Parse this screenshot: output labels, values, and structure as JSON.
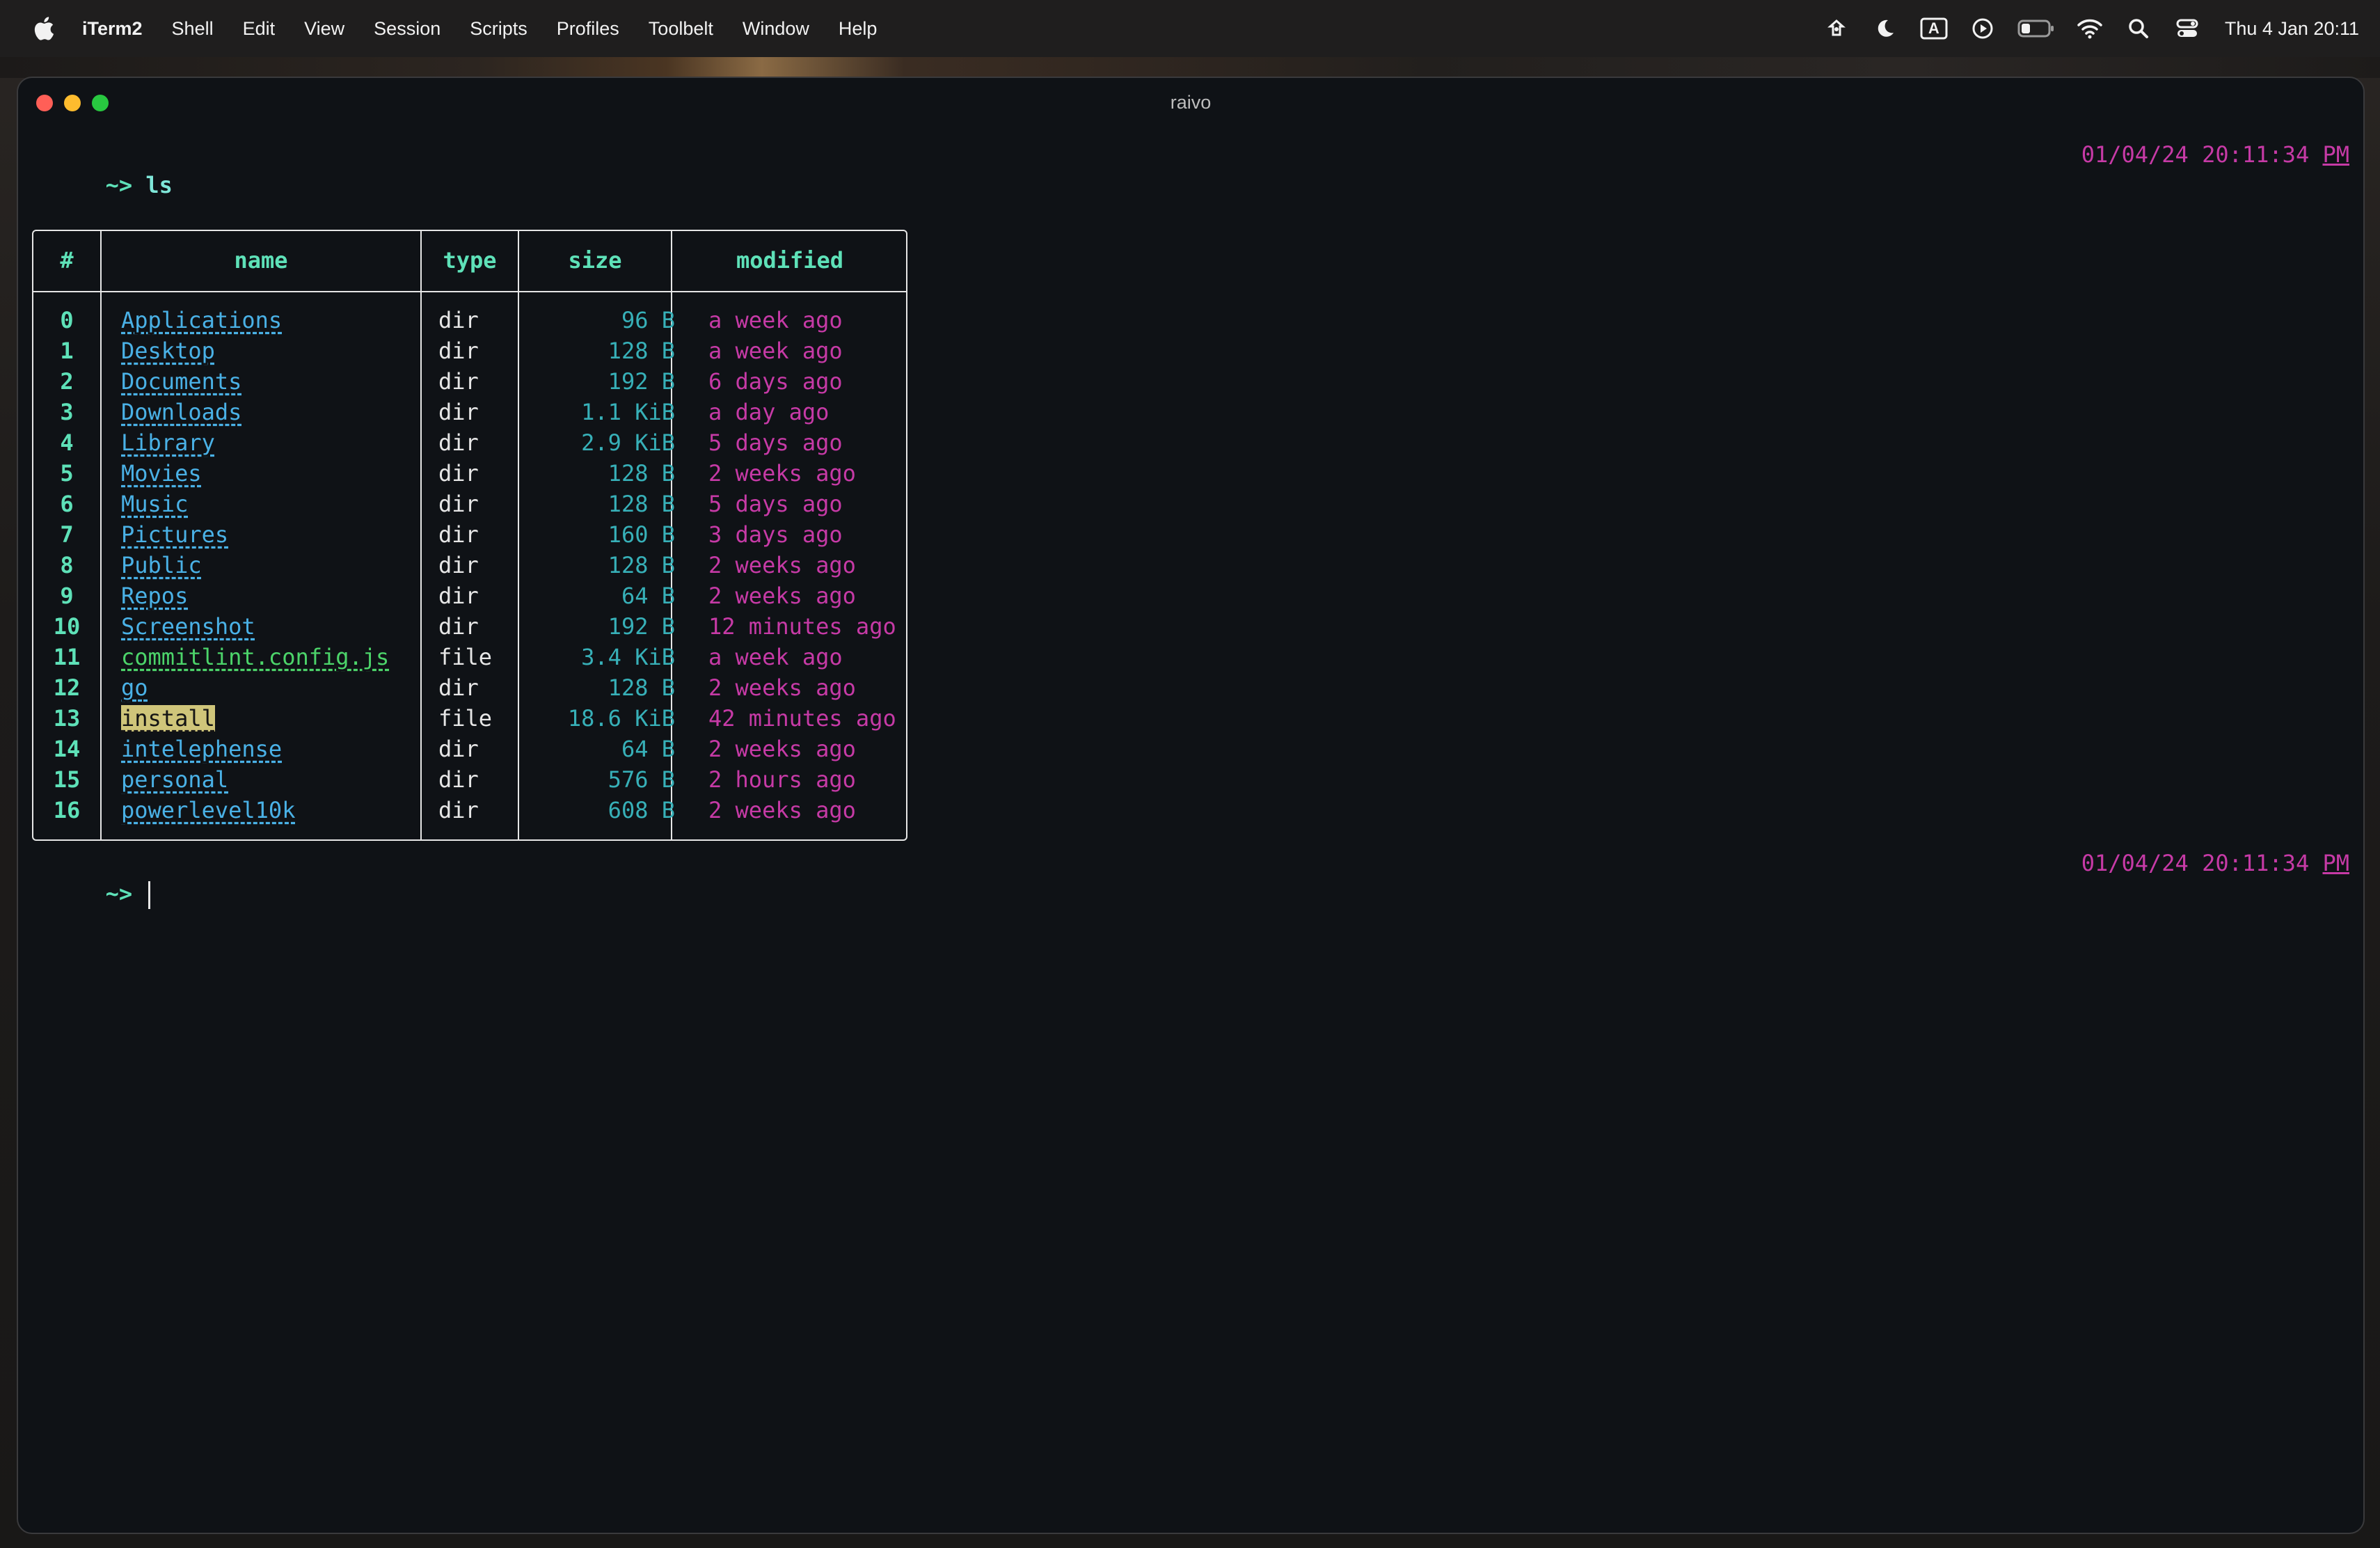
{
  "menubar": {
    "app_name": "iTerm2",
    "items": [
      "Shell",
      "Edit",
      "View",
      "Session",
      "Scripts",
      "Profiles",
      "Toolbelt",
      "Window",
      "Help"
    ],
    "clock": "Thu 4 Jan  20:11",
    "status_icons": [
      "accessibility-icon",
      "focus-moon-icon",
      "input-source-icon",
      "now-playing-icon",
      "battery-icon",
      "wifi-icon",
      "spotlight-search-icon",
      "control-center-icon"
    ],
    "input_source_label": "A"
  },
  "window": {
    "title": "raivo"
  },
  "terminal": {
    "prompt": "~>",
    "command": "ls",
    "timestamp_date": "01/04/24 20:11:34",
    "timestamp_ampm": "PM",
    "table": {
      "headers": [
        "#",
        "name",
        "type",
        "size",
        "modified"
      ],
      "rows": [
        {
          "idx": "0",
          "name": "Applications",
          "kind": "dir",
          "type": "dir",
          "size": "96 B",
          "modified": "a week ago"
        },
        {
          "idx": "1",
          "name": "Desktop",
          "kind": "dir",
          "type": "dir",
          "size": "128 B",
          "modified": "a week ago"
        },
        {
          "idx": "2",
          "name": "Documents",
          "kind": "dir",
          "type": "dir",
          "size": "192 B",
          "modified": "6 days ago"
        },
        {
          "idx": "3",
          "name": "Downloads",
          "kind": "dir",
          "type": "dir",
          "size": "1.1 KiB",
          "modified": "a day ago"
        },
        {
          "idx": "4",
          "name": "Library",
          "kind": "dir",
          "type": "dir",
          "size": "2.9 KiB",
          "modified": "5 days ago"
        },
        {
          "idx": "5",
          "name": "Movies",
          "kind": "dir",
          "type": "dir",
          "size": "128 B",
          "modified": "2 weeks ago"
        },
        {
          "idx": "6",
          "name": "Music",
          "kind": "dir",
          "type": "dir",
          "size": "128 B",
          "modified": "5 days ago"
        },
        {
          "idx": "7",
          "name": "Pictures",
          "kind": "dir",
          "type": "dir",
          "size": "160 B",
          "modified": "3 days ago"
        },
        {
          "idx": "8",
          "name": "Public",
          "kind": "dir",
          "type": "dir",
          "size": "128 B",
          "modified": "2 weeks ago"
        },
        {
          "idx": "9",
          "name": "Repos",
          "kind": "dir",
          "type": "dir",
          "size": "64 B",
          "modified": "2 weeks ago"
        },
        {
          "idx": "10",
          "name": "Screenshot",
          "kind": "dir",
          "type": "dir",
          "size": "192 B",
          "modified": "12 minutes ago"
        },
        {
          "idx": "11",
          "name": "commitlint.config.js",
          "kind": "file",
          "type": "file",
          "size": "3.4 KiB",
          "modified": "a week ago"
        },
        {
          "idx": "12",
          "name": "go",
          "kind": "dir",
          "type": "dir",
          "size": "128 B",
          "modified": "2 weeks ago"
        },
        {
          "idx": "13",
          "name": "install",
          "kind": "exec",
          "type": "file",
          "size": "18.6 KiB",
          "modified": "42 minutes ago"
        },
        {
          "idx": "14",
          "name": "intelephense",
          "kind": "dir",
          "type": "dir",
          "size": "64 B",
          "modified": "2 weeks ago"
        },
        {
          "idx": "15",
          "name": "personal",
          "kind": "dir",
          "type": "dir",
          "size": "576 B",
          "modified": "2 hours ago"
        },
        {
          "idx": "16",
          "name": "powerlevel10k",
          "kind": "dir",
          "type": "dir",
          "size": "608 B",
          "modified": "2 weeks ago"
        }
      ]
    }
  }
}
